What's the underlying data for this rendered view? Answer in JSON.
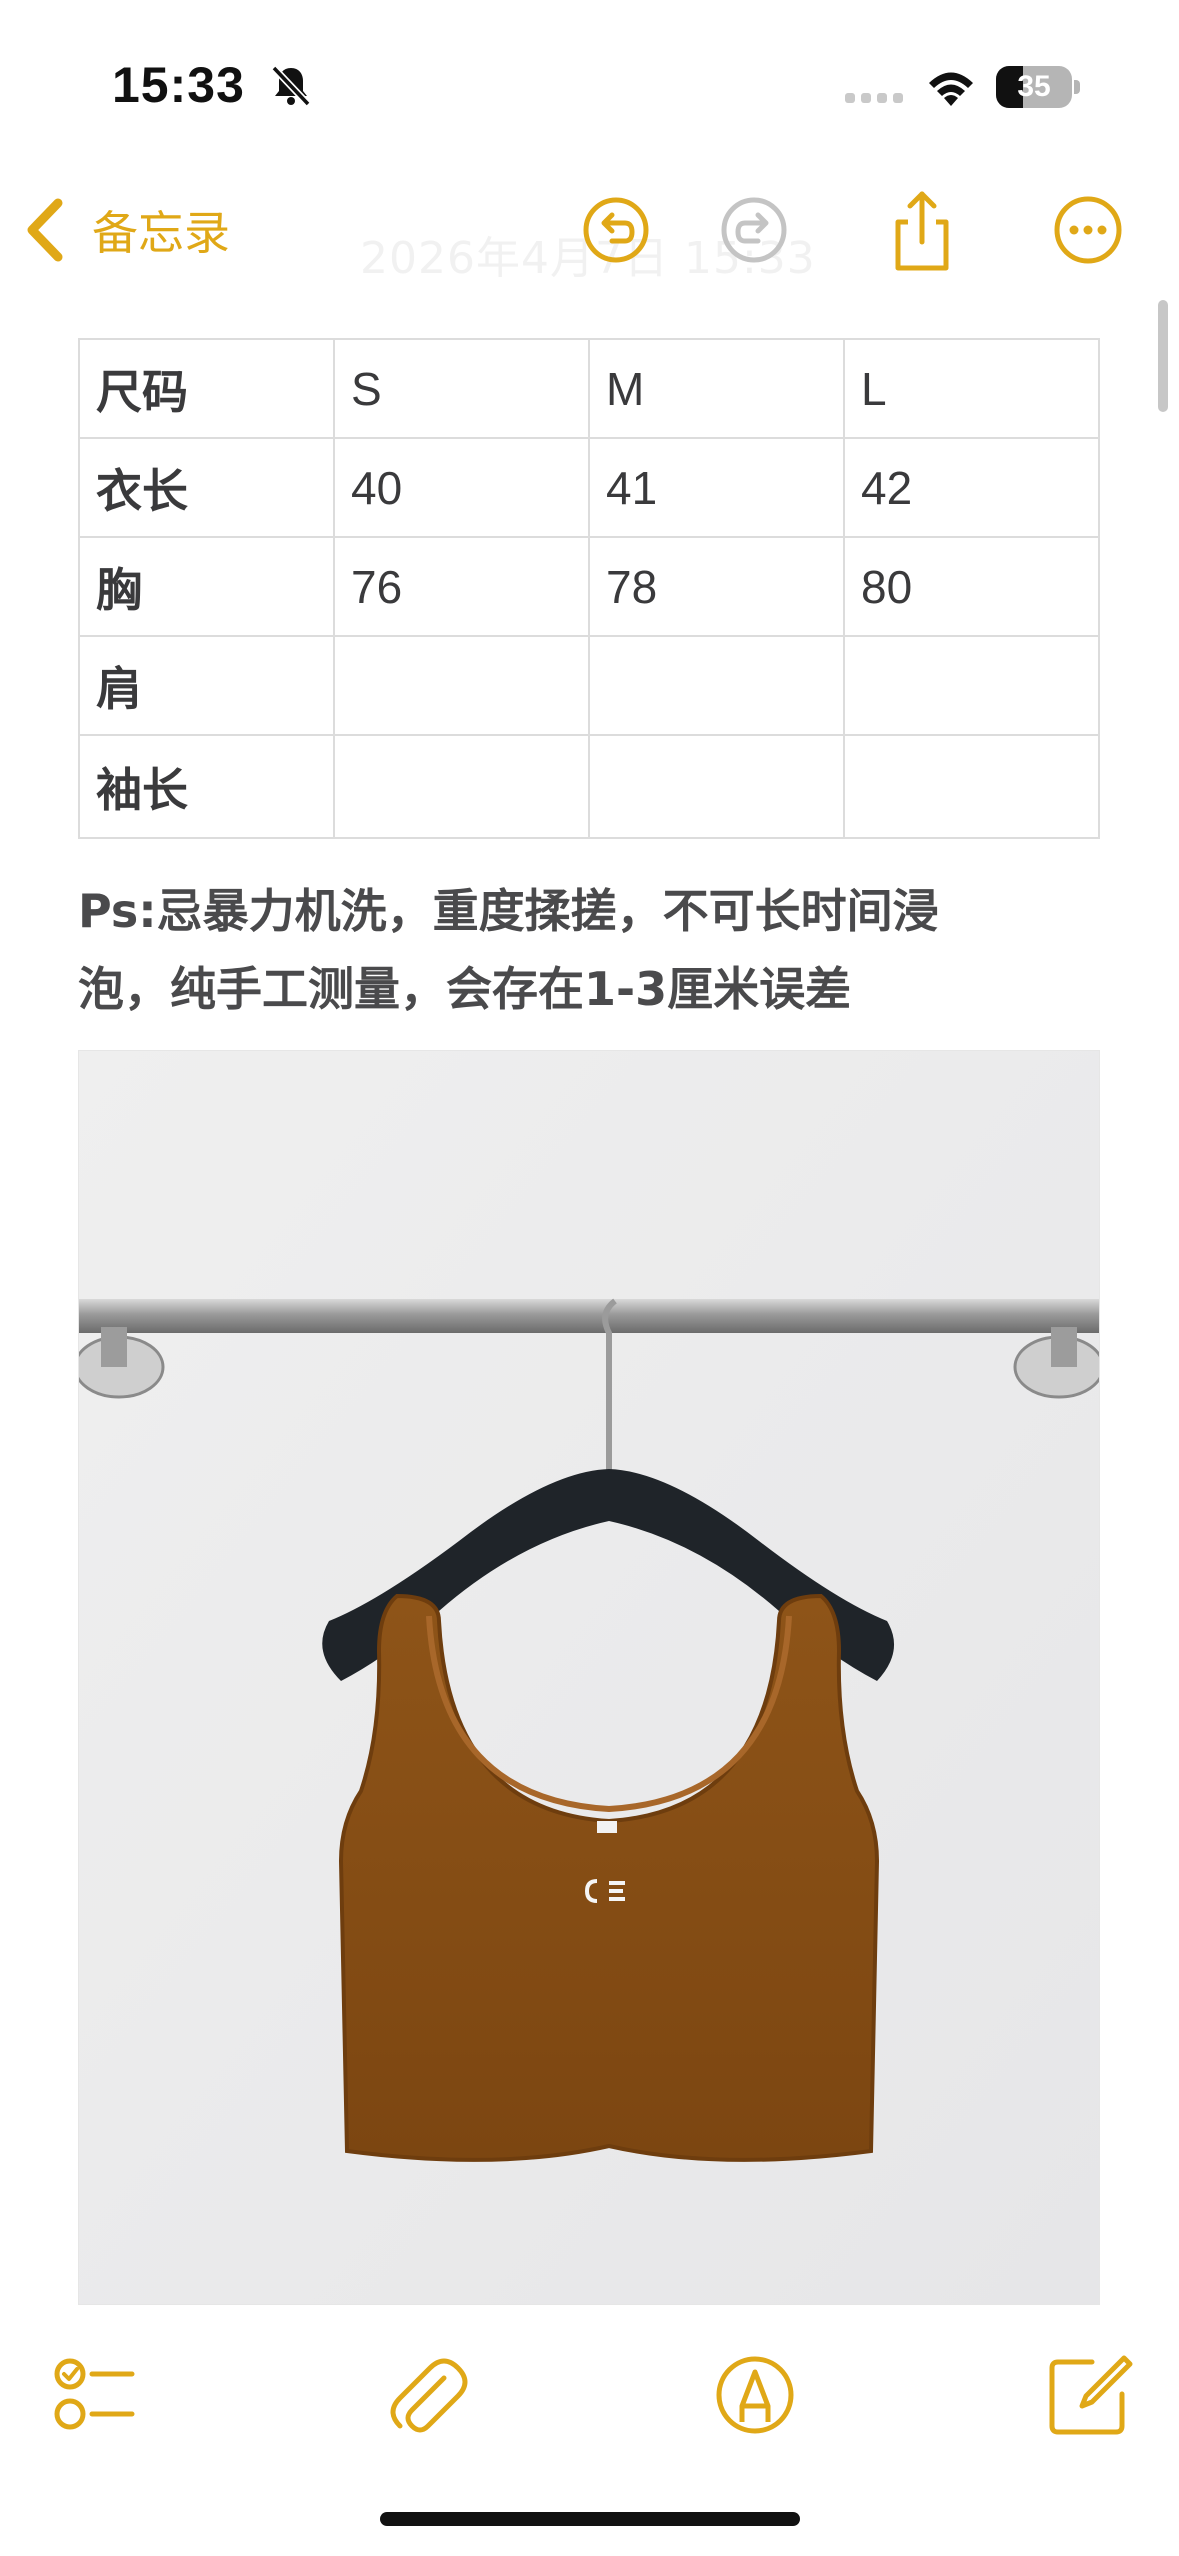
{
  "status_bar": {
    "time": "15:33",
    "battery_level": "35",
    "battery_fraction": 0.35,
    "icons": [
      "bell-slash-icon",
      "signal-icon",
      "wifi-icon",
      "battery-icon"
    ]
  },
  "nav": {
    "back_label": "备忘录",
    "faded_date": "2026年4月7日 15:33",
    "icons": [
      "chevron-left-icon",
      "undo-icon",
      "redo-icon",
      "share-icon",
      "more-icon"
    ]
  },
  "table": {
    "rows": [
      [
        "尺码",
        "S",
        "M",
        "L"
      ],
      [
        "衣长",
        "40",
        "41",
        "42"
      ],
      [
        "胸",
        "76",
        "78",
        "80"
      ],
      [
        "肩",
        "",
        "",
        ""
      ],
      [
        "袖长",
        "",
        "",
        ""
      ]
    ]
  },
  "note": {
    "line1": "Ps:忌暴力机洗，重度揉搓，不可长时间浸",
    "line2": "泡，纯手工测量，会存在1-3厘米误差"
  },
  "toolbar": {
    "icons": [
      "checklist-icon",
      "paperclip-icon",
      "markup-pen-icon",
      "compose-icon"
    ]
  },
  "colors": {
    "accent": "#e0a817",
    "text": "#3a3a3c",
    "grid": "#dcdcdc",
    "garment": "#8a5118"
  }
}
